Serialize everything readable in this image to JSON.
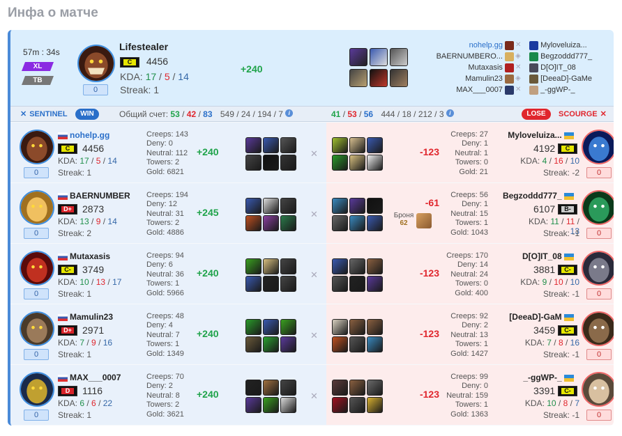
{
  "page_title": "Инфа о матче",
  "summary": {
    "duration": "57m : 34s",
    "tags": [
      "XL",
      "TB"
    ],
    "hero": "Lifestealer",
    "rank": "C",
    "rating": "4456",
    "kda_label": "KDA:",
    "kills": "17",
    "deaths": "5",
    "assists": "14",
    "streak": "Streak: 1",
    "box": "0",
    "delta": "+240",
    "players_left": [
      "nohelp.gg",
      "BAERNUMBERO...",
      "Mutaxasis",
      "Mamulin23",
      "MAX___0007"
    ],
    "players_right": [
      "Myloveluiza...",
      "Begzoddd777_",
      "D[O]IT_08",
      "[DeeaD]-GaMe",
      "_-ggWP-_"
    ]
  },
  "scorebar": {
    "sentinel": "SENTINEL",
    "win": "WIN",
    "total_label": "Общий счет:",
    "s_kills": "53",
    "s_deaths": "42",
    "s_assists": "83",
    "s_extra": "549 / 24 / 194 / 7",
    "c_kills": "41",
    "c_deaths": "53",
    "c_assists": "56",
    "c_extra": "444 / 18 / 212 / 3",
    "lose": "LOSE",
    "scourge": "SCOURGE"
  },
  "rows": [
    {
      "l": {
        "name": "nohelp.gg",
        "rank": "C",
        "rating": "4456",
        "k": "17",
        "d": "5",
        "a": "14",
        "streak": "Streak: 1",
        "box": "0",
        "creeps": "Creeps: 143",
        "deny": "Deny: 0",
        "neutral": "Neutral: 112",
        "towers": "Towers: 2",
        "gold": "Gold: 6821",
        "delta": "+240"
      },
      "r": {
        "name": "Myloveluiza...",
        "rank": "C",
        "rating": "4192",
        "k": "4",
        "d": "16",
        "a": "10",
        "streak": "Streak: -2",
        "box": "0",
        "creeps": "Creeps: 27",
        "deny": "Deny: 1",
        "neutral": "Neutral: 1",
        "towers": "Towers: 0",
        "gold": "Gold: 21",
        "delta": "-123"
      }
    },
    {
      "l": {
        "name": "BAERNUMBER",
        "rank": "D+",
        "rating": "2873",
        "k": "13",
        "d": "9",
        "a": "14",
        "streak": "Streak: 2",
        "box": "0",
        "creeps": "Creeps: 194",
        "deny": "Deny: 12",
        "neutral": "Neutral: 31",
        "towers": "Towers: 2",
        "gold": "Gold: 4886",
        "delta": "+245"
      },
      "r": {
        "name": "Begzoddd777_",
        "rank": "B-",
        "rating": "6107",
        "k": "11",
        "d": "11",
        "a": "13",
        "streak": "Streak: -1",
        "box": "0",
        "creeps": "Creeps: 56",
        "deny": "Deny: 1",
        "neutral": "Neutral: 15",
        "towers": "Towers: 1",
        "gold": "Gold: 1043",
        "delta": "-61",
        "armor_label": "Броня",
        "armor": "62"
      }
    },
    {
      "l": {
        "name": "Mutaxasis",
        "rank": "C-",
        "rating": "3749",
        "k": "10",
        "d": "13",
        "a": "17",
        "streak": "Streak: 1",
        "box": "0",
        "creeps": "Creeps: 94",
        "deny": "Deny: 6",
        "neutral": "Neutral: 36",
        "towers": "Towers: 1",
        "gold": "Gold: 5966",
        "delta": "+240"
      },
      "r": {
        "name": "D[O]IT_08",
        "rank": "C-",
        "rating": "3881",
        "k": "9",
        "d": "10",
        "a": "10",
        "streak": "Streak: -1",
        "box": "0",
        "creeps": "Creeps: 170",
        "deny": "Deny: 14",
        "neutral": "Neutral: 24",
        "towers": "Towers: 0",
        "gold": "Gold: 400",
        "delta": "-123"
      }
    },
    {
      "l": {
        "name": "Mamulin23",
        "rank": "D+",
        "rating": "2971",
        "k": "7",
        "d": "9",
        "a": "16",
        "streak": "Streak: 1",
        "box": "0",
        "creeps": "Creeps: 48",
        "deny": "Deny: 4",
        "neutral": "Neutral: 7",
        "towers": "Towers: 1",
        "gold": "Gold: 1349",
        "delta": "+240"
      },
      "r": {
        "name": "[DeeaD]-GaM",
        "rank": "C-",
        "rating": "3459",
        "k": "7",
        "d": "8",
        "a": "16",
        "streak": "Streak: -1",
        "box": "0",
        "creeps": "Creeps: 92",
        "deny": "Deny: 2",
        "neutral": "Neutral: 13",
        "towers": "Towers: 1",
        "gold": "Gold: 1427",
        "delta": "-123"
      }
    },
    {
      "l": {
        "name": "MAX___0007",
        "rank": "D",
        "rating": "1116",
        "k": "6",
        "d": "6",
        "a": "22",
        "streak": "Streak: 1",
        "box": "0",
        "creeps": "Creeps: 70",
        "deny": "Deny: 2",
        "neutral": "Neutral: 8",
        "towers": "Towers: 2",
        "gold": "Gold: 3621",
        "delta": "+240"
      },
      "r": {
        "name": "_-ggWP-_",
        "rank": "C-",
        "rating": "3391",
        "k": "10",
        "d": "8",
        "a": "7",
        "streak": "Streak: -1",
        "box": "0",
        "creeps": "Creeps: 99",
        "deny": "Deny: 0",
        "neutral": "Neutral: 159",
        "towers": "Towers: 1",
        "gold": "Gold: 1363",
        "delta": "-123"
      }
    }
  ]
}
